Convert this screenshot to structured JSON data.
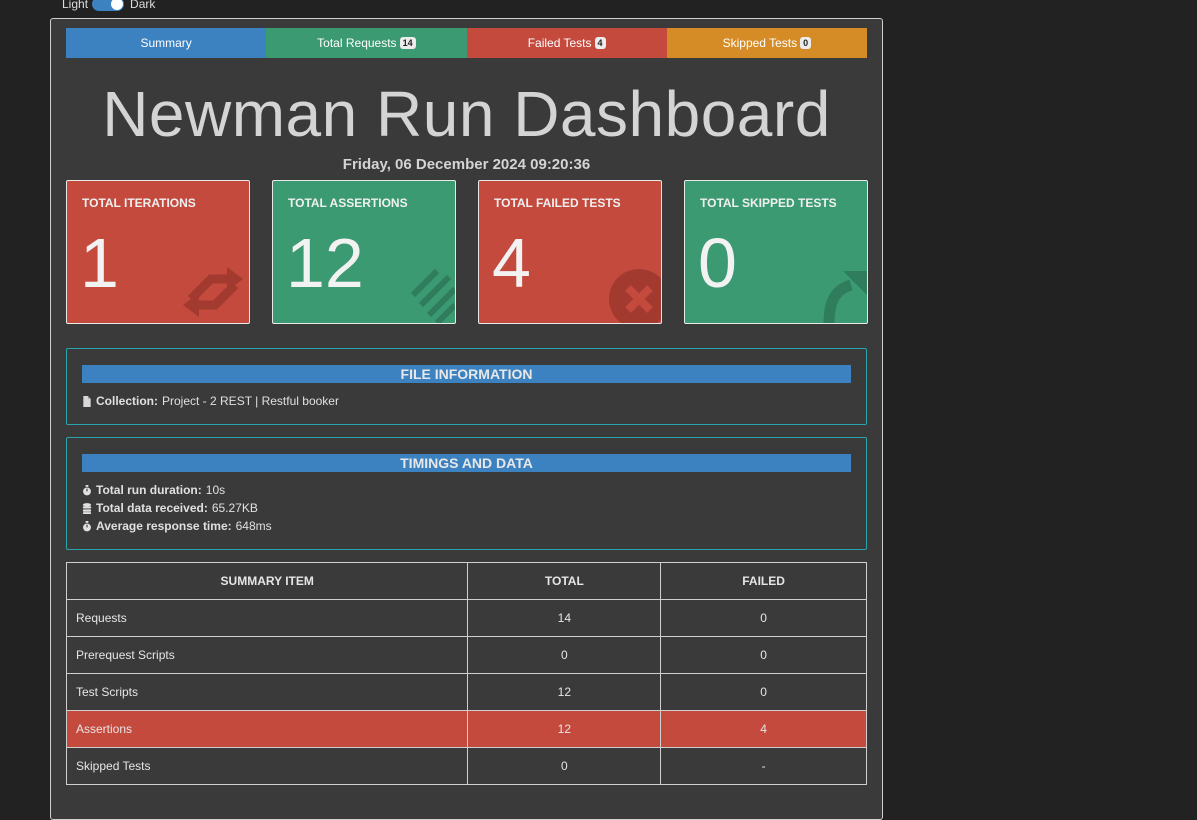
{
  "theme_toggle": {
    "light_label": "Light",
    "dark_label": "Dark"
  },
  "tabs": [
    {
      "label": "Summary",
      "badge": null,
      "color": "#3c82c0"
    },
    {
      "label": "Total Requests",
      "badge": "14",
      "color": "#3c9a72"
    },
    {
      "label": "Failed Tests",
      "badge": "4",
      "color": "#c44a3e"
    },
    {
      "label": "Skipped Tests",
      "badge": "0",
      "color": "#d58b26"
    }
  ],
  "dashboard": {
    "title": "Newman Run Dashboard",
    "run_date": "Friday, 06 December 2024 09:20:36"
  },
  "cards": [
    {
      "label": "TOTAL ITERATIONS",
      "value": "1",
      "icon": "sync-arrows-icon",
      "color": "#c44a3e"
    },
    {
      "label": "TOTAL ASSERTIONS",
      "value": "12",
      "icon": "checklist-icon",
      "color": "#3c9a72"
    },
    {
      "label": "TOTAL FAILED TESTS",
      "value": "4",
      "icon": "times-circle-icon",
      "color": "#c44a3e"
    },
    {
      "label": "TOTAL SKIPPED TESTS",
      "value": "0",
      "icon": "share-arrow-icon",
      "color": "#3c9a72"
    }
  ],
  "file_information": {
    "heading": "FILE INFORMATION",
    "collection_label": "Collection:",
    "collection_value": "Project - 2 REST | Restful booker"
  },
  "timings": {
    "heading": "TIMINGS AND DATA",
    "duration_label": "Total run duration:",
    "duration_value": "10s",
    "data_label": "Total data received:",
    "data_value": "65.27KB",
    "response_label": "Average response time:",
    "response_value": "648ms"
  },
  "summary_table": {
    "headers": [
      "SUMMARY ITEM",
      "TOTAL",
      "FAILED"
    ],
    "rows": [
      {
        "item": "Requests",
        "total": "14",
        "failed": "0"
      },
      {
        "item": "Prerequest Scripts",
        "total": "0",
        "failed": "0"
      },
      {
        "item": "Test Scripts",
        "total": "12",
        "failed": "0"
      },
      {
        "item": "Assertions",
        "total": "12",
        "failed": "4"
      },
      {
        "item": "Skipped Tests",
        "total": "0",
        "failed": "-"
      }
    ]
  }
}
